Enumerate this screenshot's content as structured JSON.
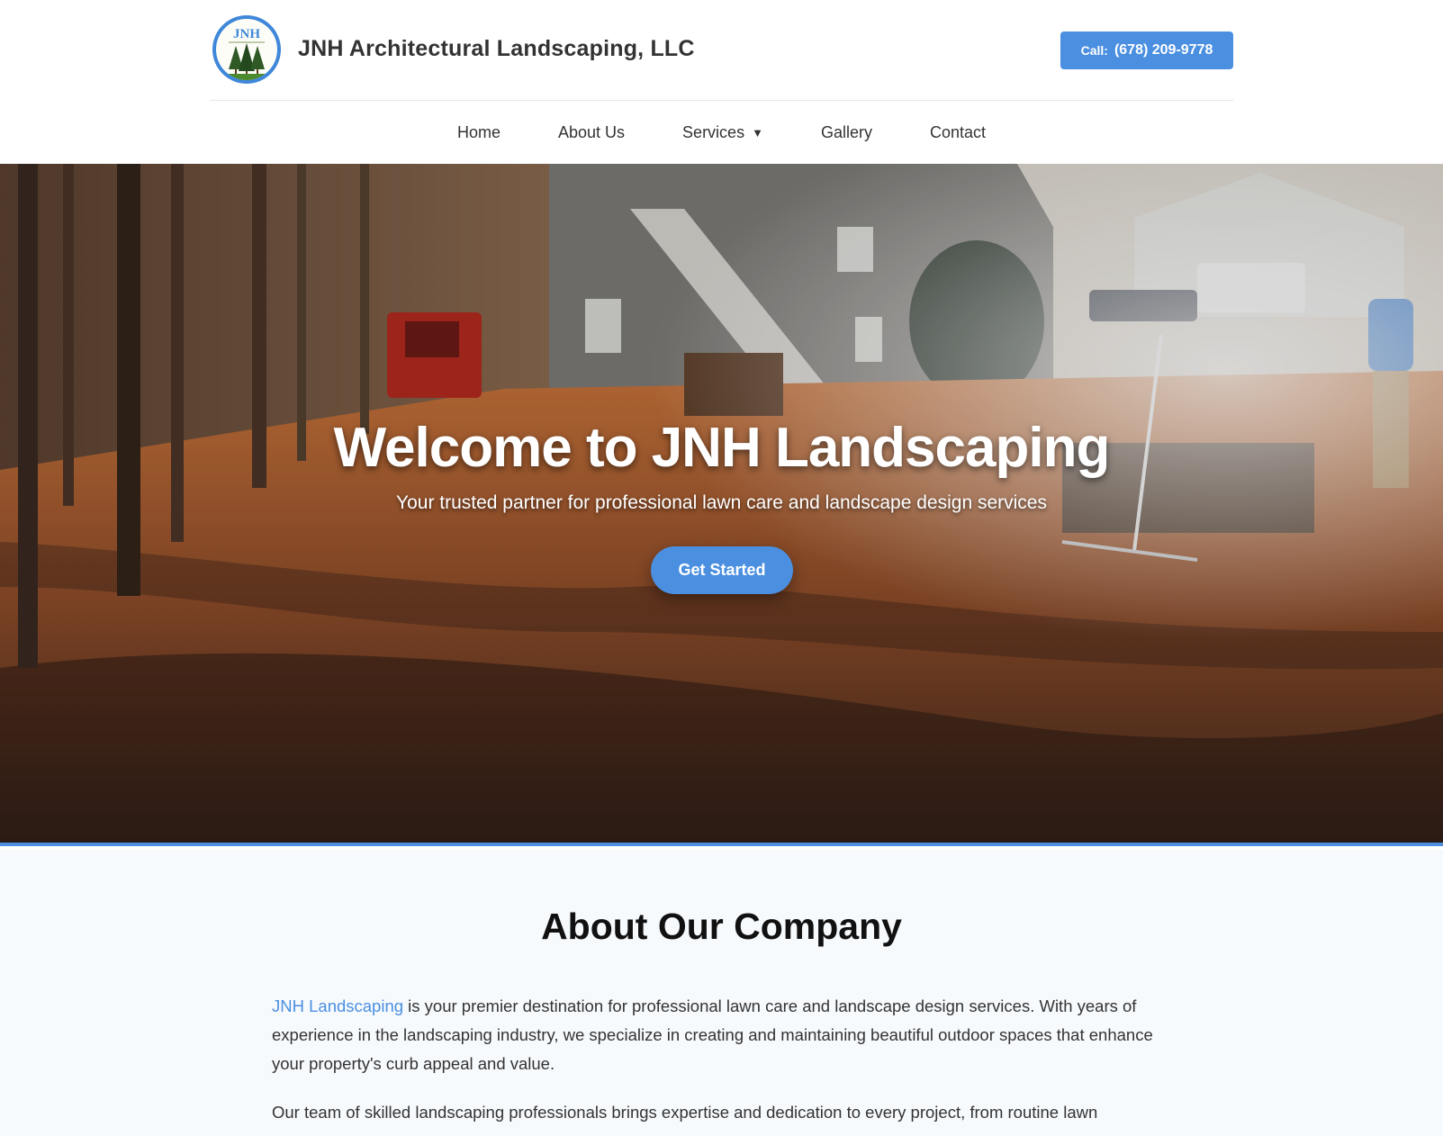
{
  "header": {
    "logo_text": "JNH",
    "brand": "JNH Architectural Landscaping, LLC",
    "call_label": "Call:",
    "call_number": "(678) 209-9778"
  },
  "nav": {
    "items": [
      {
        "label": "Home"
      },
      {
        "label": "About Us"
      },
      {
        "label": "Services",
        "icon": "caret-down-icon",
        "icon_glyph": "▼"
      },
      {
        "label": "Gallery"
      },
      {
        "label": "Contact"
      }
    ]
  },
  "hero": {
    "title": "Welcome to JNH Landscaping",
    "subtitle": "Your trusted partner for professional lawn care and landscape design services",
    "button": "Get Started"
  },
  "about": {
    "title": "About Our Company",
    "p1_link": "JNH Landscaping",
    "p1_rest": " is your premier destination for professional lawn care and landscape design services. With years of experience in the landscaping industry, we specialize in creating and maintaining beautiful outdoor spaces that enhance your property's curb appeal and value.",
    "p2": "Our team of skilled landscaping professionals brings expertise and dedication to every project, from routine lawn"
  },
  "colors": {
    "accent": "#4a8fe0",
    "text": "#333333",
    "about_bg": "#f7fafd"
  }
}
